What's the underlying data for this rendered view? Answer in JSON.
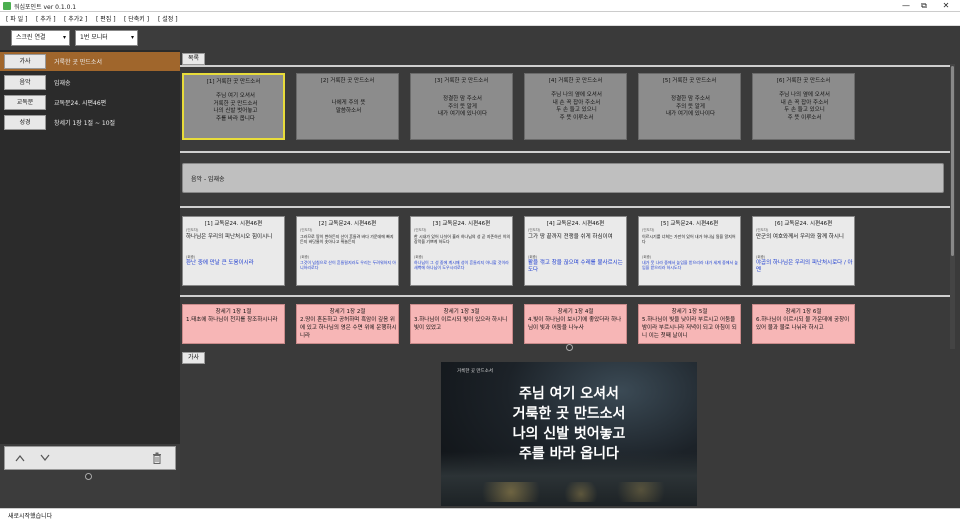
{
  "window": {
    "title": "워십포인트 ver 0.1.0.1",
    "minimize": "—",
    "maximize": "⧉",
    "close": "✕"
  },
  "menu": [
    "[ 파 일 ]",
    "[ 추가 ]",
    "[ 추가2 ]",
    "[ 편집 ]",
    "[ 단축키 ]",
    "[ 설정 ]"
  ],
  "controls": {
    "display_mode": "스크린 연결",
    "monitor": "1번 모니터"
  },
  "left_items": [
    {
      "button": "가사",
      "text": "거룩한 곳 만드소서",
      "active": true
    },
    {
      "button": "음악",
      "text": "임재송",
      "active": false
    },
    {
      "button": "교독문",
      "text": "교독문24.  시편46편",
      "active": false
    },
    {
      "button": "성경",
      "text": "창세기 1장 1절 ~ 10절",
      "active": false
    }
  ],
  "sections": {
    "contents_tab": "목록",
    "preview_tab": "가사"
  },
  "lyric_slides": [
    {
      "title": "[1] 거룩한 곳 만드소서",
      "body": "주님 여기 오셔서\n거룩한 곳 만드소서\n나의 신발 벗어놓고\n주를 바라 옵니다",
      "selected": true
    },
    {
      "title": "[2] 거룩한 곳 만드소서",
      "body": "나에게 주의 뜻\n말씀하소서",
      "selected": false
    },
    {
      "title": "[3] 거룩한 곳 만드소서",
      "body": "정결한 맘 주소서\n주의 뜻 알게\n내가 여기에 있나이다",
      "selected": false
    },
    {
      "title": "[4] 거룩한 곳 만드소서",
      "body": "주님 나의 옆에 오셔서\n내 손 꼭 잡아 주소서\n두 손 들고 있으니\n주 뜻 이루소서",
      "selected": false
    },
    {
      "title": "[5] 거룩한 곳 만드소서",
      "body": "정결한 맘 주소서\n주의 뜻 알게\n내가 여기에 있나이다",
      "selected": false
    },
    {
      "title": "[6] 거룩한 곳 만드소서",
      "body": "주님 나의 옆에 오셔서\n내 손 꼭 잡아 주소서\n두 손 들고 있으니\n주 뜻 이루소서",
      "selected": false
    }
  ],
  "music_item": "음악 - 임재송",
  "responsive_slides": [
    {
      "title": "[1] 교독문24.  시편46편",
      "tag1": "(인도자)",
      "line1": "하나님은 우리의 피난처시오 힘이시니",
      "tag2": "(회중)",
      "line2": "환난 중에 만날 큰 도움이시라",
      "small": false
    },
    {
      "title": "[2] 교독문24.  시편46편",
      "tag1": "(인도자)",
      "line1": "그러므로 땅이 변하든지 산이 흔들려 바다 가운데에 빠지든지 바닷물이 솟아나고 뛰놀든지",
      "tag2": "(회중)",
      "line2": "그것이 넘침으로 산이 흔들릴지라도 우리는 두려워하지 아니하리로다",
      "small": true
    },
    {
      "title": "[3] 교독문24.  시편46편",
      "tag1": "(인도자)",
      "line1": "한 시내가 있어 나뉘어 흘러 하나님의 성 곧 지존하신 이의 장막을 기쁘게 하도다",
      "tag2": "(회중)",
      "line2": "하나님이 그 성 중에 계시매 성이 흔들리지 아니할 것이라 새벽에 하나님이 도우시리로다",
      "small": true
    },
    {
      "title": "[4] 교독문24.  시편46편",
      "tag1": "(인도자)",
      "line1": "그가 땅 끝까지 전쟁을 쉬게 하심이여",
      "tag2": "(회중)",
      "line2": "활을 꺾고 창을 끊으며 수레를 불사르시는도다",
      "small": false
    },
    {
      "title": "[5] 교독문24.  시편46편",
      "tag1": "(인도자)",
      "line1": "이르시기를 너희는 가만히 있어 내가 하나님 됨을 알지어다",
      "tag2": "(회중)",
      "line2": "내가 뭇 나라 중에서 높임을 받으리라 내가 세계 중에서 높임을 받으리라 하시도다",
      "small": true
    },
    {
      "title": "[6] 교독문24.  시편46편",
      "tag1": "(인도자)",
      "line1": "만군의 여호와께서 우리와 함께 하시니",
      "tag2": "(회중)",
      "line2": "야곱의 하나님은 우리의 피난처시로다 / 아멘",
      "small": false
    }
  ],
  "bible_slides": [
    {
      "title": "창세기 1장 1절",
      "body": "1.태초에 하나님이 천지를 창조하시니라"
    },
    {
      "title": "창세기 1장 2절",
      "body": "2.땅이 혼돈하고 공허하며 흑암이 깊음 위에 있고 하나님의 영은 수면 위에 운행하시니라"
    },
    {
      "title": "창세기 1장 3절",
      "body": "3.하나님이 이르시되 빛이 있으라 하시니 빛이 있었고"
    },
    {
      "title": "창세기 1장 4절",
      "body": "4.빛이 하나님이 보시기에 좋았더라 하나님이 빛과 어둠을 나누사"
    },
    {
      "title": "창세기 1장 5절",
      "body": "5.하나님이 빛을 낮이라 부르시고 어둠을 밤이라 부르시니라 저녁이 되고 아침이 되니 이는 첫째 날이니"
    },
    {
      "title": "창세기 1장 6절",
      "body": "6.하나님이 이르시되 물 가운데에 궁창이 있어 물과 물로 나뉘라 하시고"
    }
  ],
  "preview": {
    "caption": "거룩한 곳 만드소서",
    "lines": [
      "주님 여기 오셔서",
      "거룩한 곳 만드소서",
      "나의 신발 벗어놓고",
      "주를 바라 옵니다"
    ]
  },
  "status": "새로시작했습니다",
  "icons": {
    "up": "up-arrow-icon",
    "down": "down-arrow-icon",
    "delete": "trash-icon"
  },
  "colors": {
    "active_item": "#a0662c",
    "selected_border": "#e8dc3a",
    "bible_card": "#f7b6b6",
    "responsive_blue": "#1a3ad0"
  }
}
